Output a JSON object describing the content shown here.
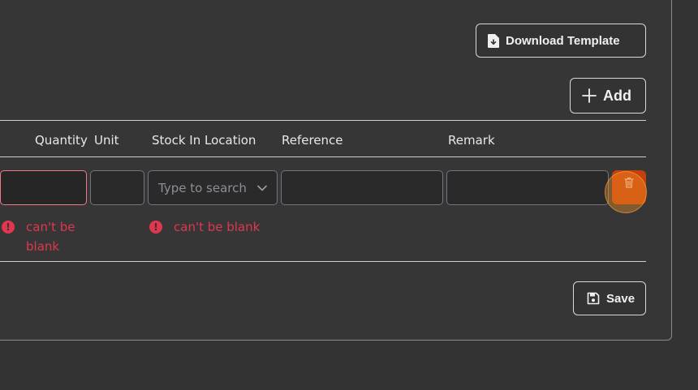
{
  "toolbar": {
    "download_label": "Download Template",
    "add_label": "Add",
    "save_label": "Save"
  },
  "table": {
    "columns": [
      "Quantity",
      "Unit",
      "Stock In Location",
      "Reference",
      "Remark"
    ],
    "row": {
      "quantity": "",
      "unit": "",
      "location_placeholder": "Type to search",
      "reference": "",
      "remark": ""
    },
    "errors": {
      "quantity": "can't be blank",
      "location": "can't be blank"
    }
  },
  "icons": {
    "download": "file-download-icon",
    "add": "plus-icon",
    "save": "floppy-disk-icon",
    "delete": "trash-icon",
    "dropdown": "chevron-down-icon",
    "error": "exclamation-circle-icon"
  },
  "colors": {
    "background": "#333333",
    "error": "#e0374f",
    "delete": "#c2410c"
  }
}
